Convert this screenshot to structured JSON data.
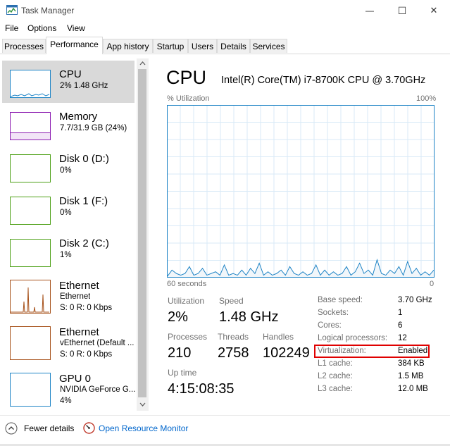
{
  "window": {
    "title": "Task Manager",
    "minimize_glyph": "—",
    "maximize_glyph": "☐",
    "close_glyph": "✕"
  },
  "menu": [
    "File",
    "Options",
    "View"
  ],
  "tabs": [
    "Processes",
    "Performance",
    "App history",
    "Startup",
    "Users",
    "Details",
    "Services"
  ],
  "active_tab": "Performance",
  "sidebar": [
    {
      "name": "CPU",
      "line1": "2% 1.48 GHz",
      "line2": "",
      "color": "#1e84c6"
    },
    {
      "name": "Memory",
      "line1": "7.7/31.9 GB (24%)",
      "line2": "",
      "color": "#8b1ab0"
    },
    {
      "name": "Disk 0 (D:)",
      "line1": "0%",
      "line2": "",
      "color": "#4da016"
    },
    {
      "name": "Disk 1 (F:)",
      "line1": "0%",
      "line2": "",
      "color": "#4da016"
    },
    {
      "name": "Disk 2 (C:)",
      "line1": "1%",
      "line2": "",
      "color": "#4da016"
    },
    {
      "name": "Ethernet",
      "line1": "Ethernet",
      "line2": "S: 0 R: 0 Kbps",
      "color": "#a7521b"
    },
    {
      "name": "Ethernet",
      "line1": "vEthernet (Default ...",
      "line2": "S: 0 R: 0 Kbps",
      "color": "#a7521b"
    },
    {
      "name": "GPU 0",
      "line1": "NVIDIA GeForce G...",
      "line2": "4%",
      "color": "#1e84c6"
    }
  ],
  "main": {
    "title": "CPU",
    "model": "Intel(R) Core(TM) i7-8700K CPU @ 3.70GHz",
    "graph_label_left": "% Utilization",
    "graph_label_right": "100%",
    "graph_bottom_left": "60 seconds",
    "graph_bottom_right": "0",
    "utilization_label": "Utilization",
    "utilization_value": "2%",
    "speed_label": "Speed",
    "speed_value": "1.48 GHz",
    "processes_label": "Processes",
    "processes_value": "210",
    "threads_label": "Threads",
    "threads_value": "2758",
    "handles_label": "Handles",
    "handles_value": "102249",
    "uptime_label": "Up time",
    "uptime_value": "4:15:08:35",
    "cpu_history_percent": [
      0.5,
      4,
      2,
      1,
      2,
      6,
      1,
      2,
      5,
      1,
      2,
      3,
      1,
      7,
      1,
      2,
      1,
      4,
      1,
      5,
      2,
      8,
      1,
      3,
      1,
      2,
      4,
      1,
      6,
      2,
      1,
      3,
      1,
      2,
      7,
      1,
      4,
      1,
      3,
      1,
      2,
      6,
      1,
      3,
      8,
      2,
      4,
      1,
      10,
      2,
      1,
      4,
      2,
      6,
      1,
      9,
      2,
      5,
      1,
      3,
      1,
      4
    ]
  },
  "specs": [
    {
      "label": "Base speed:",
      "value": "3.70 GHz"
    },
    {
      "label": "Sockets:",
      "value": "1"
    },
    {
      "label": "Cores:",
      "value": "6"
    },
    {
      "label": "Logical processors:",
      "value": "12"
    },
    {
      "label": "Virtualization:",
      "value": "Enabled"
    },
    {
      "label": "L1 cache:",
      "value": "384 KB"
    },
    {
      "label": "L2 cache:",
      "value": "1.5 MB"
    },
    {
      "label": "L3 cache:",
      "value": "12.0 MB"
    }
  ],
  "footer": {
    "fewer_details": "Fewer details",
    "open_monitor": "Open Resource Monitor"
  }
}
